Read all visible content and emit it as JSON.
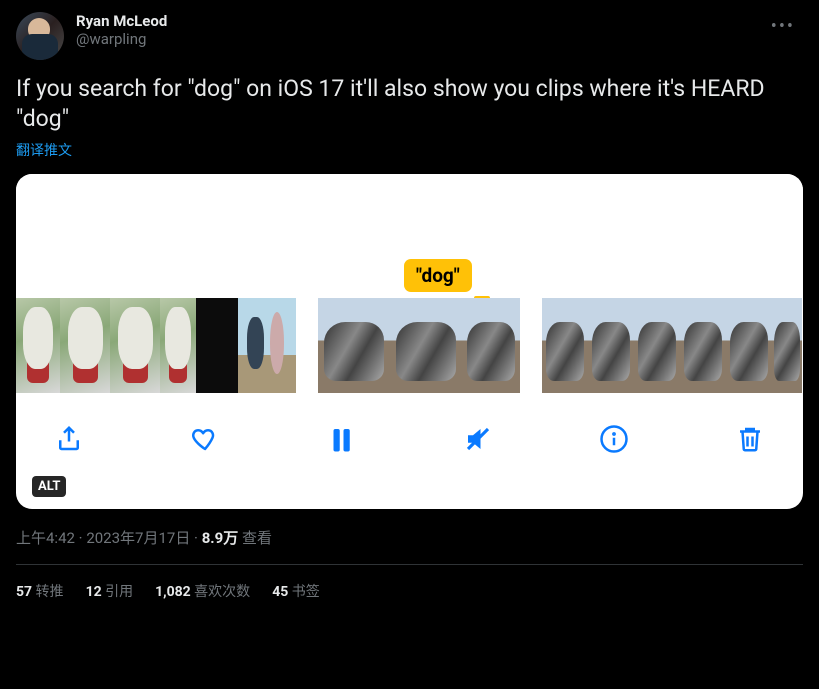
{
  "header": {
    "display_name": "Ryan McLeod",
    "handle": "@warpling"
  },
  "tweet_text": "If you search for \"dog\" on iOS 17 it'll also show you clips where it's HEARD \"dog\"",
  "translate_label": "翻译推文",
  "media": {
    "search_term_label": "\"dog\"",
    "alt_badge": "ALT"
  },
  "meta": {
    "time": "上午4:42",
    "dot1": " · ",
    "date": "2023年7月17日",
    "dot2": " · ",
    "views_count": "8.9万",
    "views_label": " 查看"
  },
  "stats": {
    "retweets_count": "57",
    "retweets_label": " 转推",
    "quotes_count": "12",
    "quotes_label": " 引用",
    "likes_count": "1,082",
    "likes_label": " 喜欢次数",
    "bookmarks_count": "45",
    "bookmarks_label": " 书签"
  }
}
